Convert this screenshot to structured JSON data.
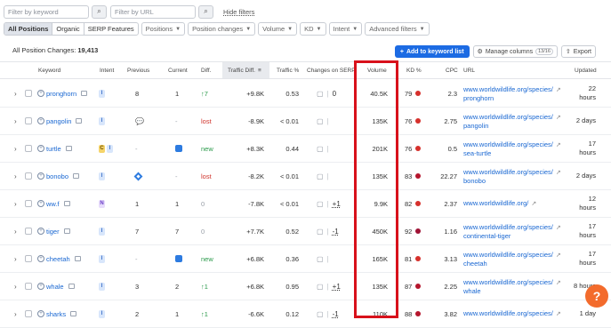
{
  "filters": {
    "keyword_placeholder": "Filter by keyword",
    "url_placeholder": "Filter by URL",
    "hide_filters": "Hide filters"
  },
  "tabs": [
    "All Positions",
    "Organic",
    "SERP Features"
  ],
  "dropdowns": [
    "Positions",
    "Position changes",
    "Volume",
    "KD",
    "Intent",
    "Advanced filters"
  ],
  "summary": {
    "label": "All Position Changes:",
    "count": "19,413"
  },
  "toolbar": {
    "add_label": "Add to keyword list",
    "manage_label": "Manage columns",
    "manage_count": "13/16",
    "export_label": "Export"
  },
  "columns": [
    "Keyword",
    "Intent",
    "Previous",
    "Current",
    "Diff.",
    "Traffic Diff.",
    "Traffic %",
    "Changes on SERP",
    "Volume",
    "KD %",
    "CPC",
    "URL",
    "Updated"
  ],
  "rows": [
    {
      "keyword": "pronghorn",
      "intent": [
        "I"
      ],
      "previous": "8",
      "current": "1",
      "diff": "↑7",
      "diff_type": "up",
      "traffic_diff": "+9.8K",
      "traffic_pct": "0.53",
      "serp_changes": "0",
      "volume": "40.5K",
      "kd": "79",
      "kd_color": "#d6302c",
      "cpc": "2.3",
      "url": [
        "www.worldwildlife.org/species/",
        "pronghorn"
      ],
      "updated": [
        "22",
        "hours"
      ]
    },
    {
      "keyword": "pangolin",
      "intent": [
        "I"
      ],
      "previous": "msg-icon",
      "current": "-",
      "diff": "lost",
      "diff_type": "lost",
      "traffic_diff": "-8.9K",
      "traffic_pct": "< 0.01",
      "serp_changes": "",
      "volume": "135K",
      "kd": "76",
      "kd_color": "#d6302c",
      "cpc": "2.75",
      "url": [
        "www.worldwildlife.org/species/",
        "pangolin"
      ],
      "updated": [
        "2 days"
      ]
    },
    {
      "keyword": "turtle",
      "intent": [
        "C",
        "I"
      ],
      "previous": "-",
      "current": "img-icon",
      "diff": "new",
      "diff_type": "new",
      "traffic_diff": "+8.3K",
      "traffic_pct": "0.44",
      "serp_changes": "",
      "volume": "201K",
      "kd": "76",
      "kd_color": "#d6302c",
      "cpc": "0.5",
      "url": [
        "www.worldwildlife.org/species/",
        "sea-turtle"
      ],
      "updated": [
        "17",
        "hours"
      ]
    },
    {
      "keyword": "bonobo",
      "intent": [
        "I"
      ],
      "previous": "diamond-icon",
      "current": "-",
      "diff": "lost",
      "diff_type": "lost",
      "traffic_diff": "-8.2K",
      "traffic_pct": "< 0.01",
      "serp_changes": "",
      "volume": "135K",
      "kd": "83",
      "kd_color": "#b5162d",
      "cpc": "22.27",
      "url": [
        "www.worldwildlife.org/species/",
        "bonobo"
      ],
      "updated": [
        "2 days"
      ]
    },
    {
      "keyword": "ww.f",
      "intent": [
        "N"
      ],
      "previous": "1",
      "current": "1",
      "diff": "0",
      "diff_type": "zero",
      "traffic_diff": "-7.8K",
      "traffic_pct": "< 0.01",
      "serp_changes": "+1",
      "volume": "9.9K",
      "kd": "82",
      "kd_color": "#d6302c",
      "cpc": "2.37",
      "url": [
        "www.worldwildlife.org/"
      ],
      "updated": [
        "12",
        "hours"
      ]
    },
    {
      "keyword": "tiger",
      "intent": [
        "I"
      ],
      "previous": "7",
      "current": "7",
      "diff": "0",
      "diff_type": "zero",
      "traffic_diff": "+7.7K",
      "traffic_pct": "0.52",
      "serp_changes": "-1",
      "volume": "450K",
      "kd": "92",
      "kd_color": "#9f1336",
      "cpc": "1.16",
      "url": [
        "www.worldwildlife.org/species/",
        "continental-tiger"
      ],
      "updated": [
        "17",
        "hours"
      ]
    },
    {
      "keyword": "cheetah",
      "intent": [
        "I"
      ],
      "previous": "-",
      "current": "img-icon",
      "diff": "new",
      "diff_type": "new",
      "traffic_diff": "+6.8K",
      "traffic_pct": "0.36",
      "serp_changes": "",
      "volume": "165K",
      "kd": "81",
      "kd_color": "#d6302c",
      "cpc": "3.13",
      "url": [
        "www.worldwildlife.org/species/",
        "cheetah"
      ],
      "updated": [
        "17",
        "hours"
      ]
    },
    {
      "keyword": "whale",
      "intent": [
        "I"
      ],
      "previous": "3",
      "current": "2",
      "diff": "↑1",
      "diff_type": "up",
      "traffic_diff": "+6.8K",
      "traffic_pct": "0.95",
      "serp_changes": "+1",
      "volume": "135K",
      "kd": "87",
      "kd_color": "#b5162d",
      "cpc": "2.25",
      "url": [
        "www.worldwildlife.org/species/",
        "whale"
      ],
      "updated": [
        "8 hours"
      ]
    },
    {
      "keyword": "sharks",
      "intent": [
        "I"
      ],
      "previous": "2",
      "current": "1",
      "diff": "↑1",
      "diff_type": "up",
      "traffic_diff": "-6.6K",
      "traffic_pct": "0.12",
      "serp_changes": "-1",
      "volume": "110K",
      "kd": "88",
      "kd_color": "#b5162d",
      "cpc": "3.82",
      "url": [
        "www.worldwildlife.org/species/"
      ],
      "updated": [
        "1 day"
      ]
    }
  ],
  "help_label": "?"
}
